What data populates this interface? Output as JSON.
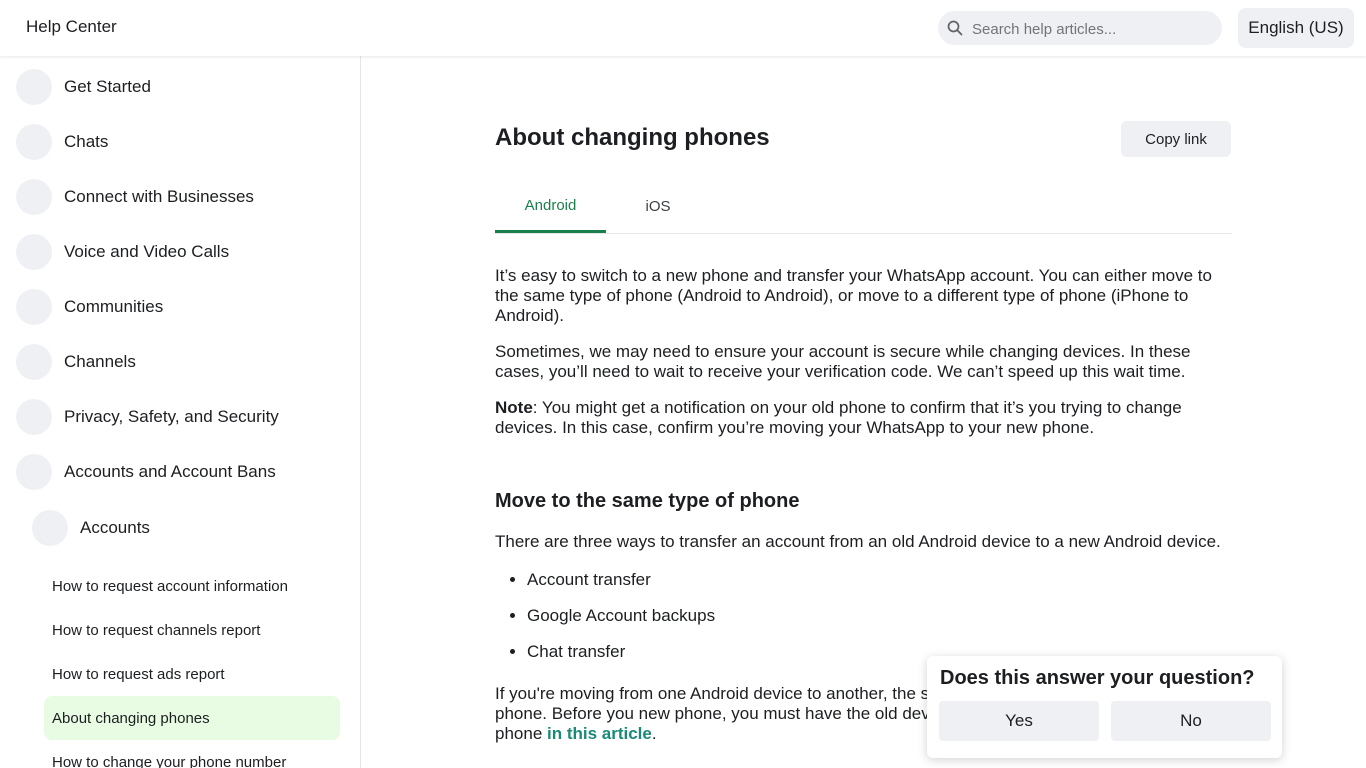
{
  "header": {
    "brand": "Help Center",
    "search_placeholder": "Search help articles...",
    "language": "English (US)"
  },
  "sidebar": {
    "categories": [
      "Get Started",
      "Chats",
      "Connect with Businesses",
      "Voice and Video Calls",
      "Communities",
      "Channels",
      "Privacy, Safety, and Security",
      "Accounts and Account Bans"
    ],
    "subcategory": "Accounts",
    "articles": [
      "How to request account information",
      "How to request channels report",
      "How to request ads report",
      "About changing phones",
      "How to change your phone number"
    ]
  },
  "article": {
    "title": "About changing phones",
    "copy_link": "Copy link",
    "tabs": [
      "Android",
      "iOS"
    ],
    "p1": "It’s easy to switch to a new phone and transfer your WhatsApp account. You can either move to the same type of phone (Android to Android), or move to a different type of phone (iPhone to Android).",
    "p2": "Sometimes, we may need to ensure your account is secure while changing devices. In these cases, you’ll need to wait to receive your verification code. We can’t speed up this wait time.",
    "note_label": "Note",
    "note_text": ": You might get a notification on your old phone to confirm that it’s you trying to change devices. In this case, confirm you’re moving your WhatsApp to your new phone.",
    "h2": "Move to the same type of phone",
    "p3": "There are three ways to transfer an account from an old Android device to a new Android device.",
    "list": [
      "Account transfer",
      "Google Account backups",
      "Chat transfer"
    ],
    "p4": "If you're moving from one Android device to another, the simple and best way to move to a new phone. Before you new phone, you must have the old device active to scan th account to a new phone ",
    "p4_link": "in this article",
    "p4_end": "."
  },
  "feedback": {
    "question": "Does this answer your question?",
    "yes": "Yes",
    "no": "No"
  }
}
